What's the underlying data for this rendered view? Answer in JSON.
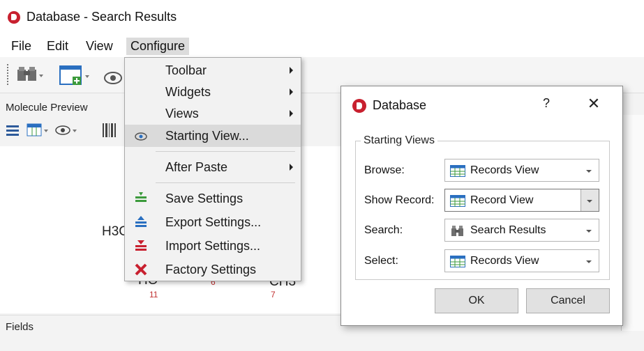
{
  "window": {
    "title": "Database - Search Results"
  },
  "menubar": {
    "items": [
      "File",
      "Edit",
      "View",
      "Configure"
    ]
  },
  "panels": {
    "molecule_preview": "Molecule Preview",
    "fields": "Fields"
  },
  "molecule": {
    "labels": [
      "H3C",
      "HO",
      "CH3"
    ],
    "numbers": [
      "11",
      "6",
      "7"
    ]
  },
  "configure_menu": {
    "toolbar": "Toolbar",
    "widgets": "Widgets",
    "views": "Views",
    "starting_view": "Starting View...",
    "after_paste": "After Paste",
    "save_settings": "Save Settings",
    "export_settings": "Export Settings...",
    "import_settings": "Import Settings...",
    "factory_settings": "Factory Settings"
  },
  "dialog": {
    "title": "Database",
    "help": "?",
    "close": "✕",
    "group_title": "Starting Views",
    "rows": [
      {
        "label": "Browse:",
        "value": "Records View",
        "icon": "records-view-icon"
      },
      {
        "label": "Show Record:",
        "value": "Record View",
        "icon": "records-view-icon"
      },
      {
        "label": "Search:",
        "value": "Search Results",
        "icon": "binoculars-icon"
      },
      {
        "label": "Select:",
        "value": "Records View",
        "icon": "records-view-icon"
      }
    ],
    "ok": "OK",
    "cancel": "Cancel"
  },
  "colors": {
    "brand": "#c8202f",
    "number_red": "#c03030",
    "grid_blue": "#2a6fc0",
    "grid_green": "#3c9a3c"
  }
}
